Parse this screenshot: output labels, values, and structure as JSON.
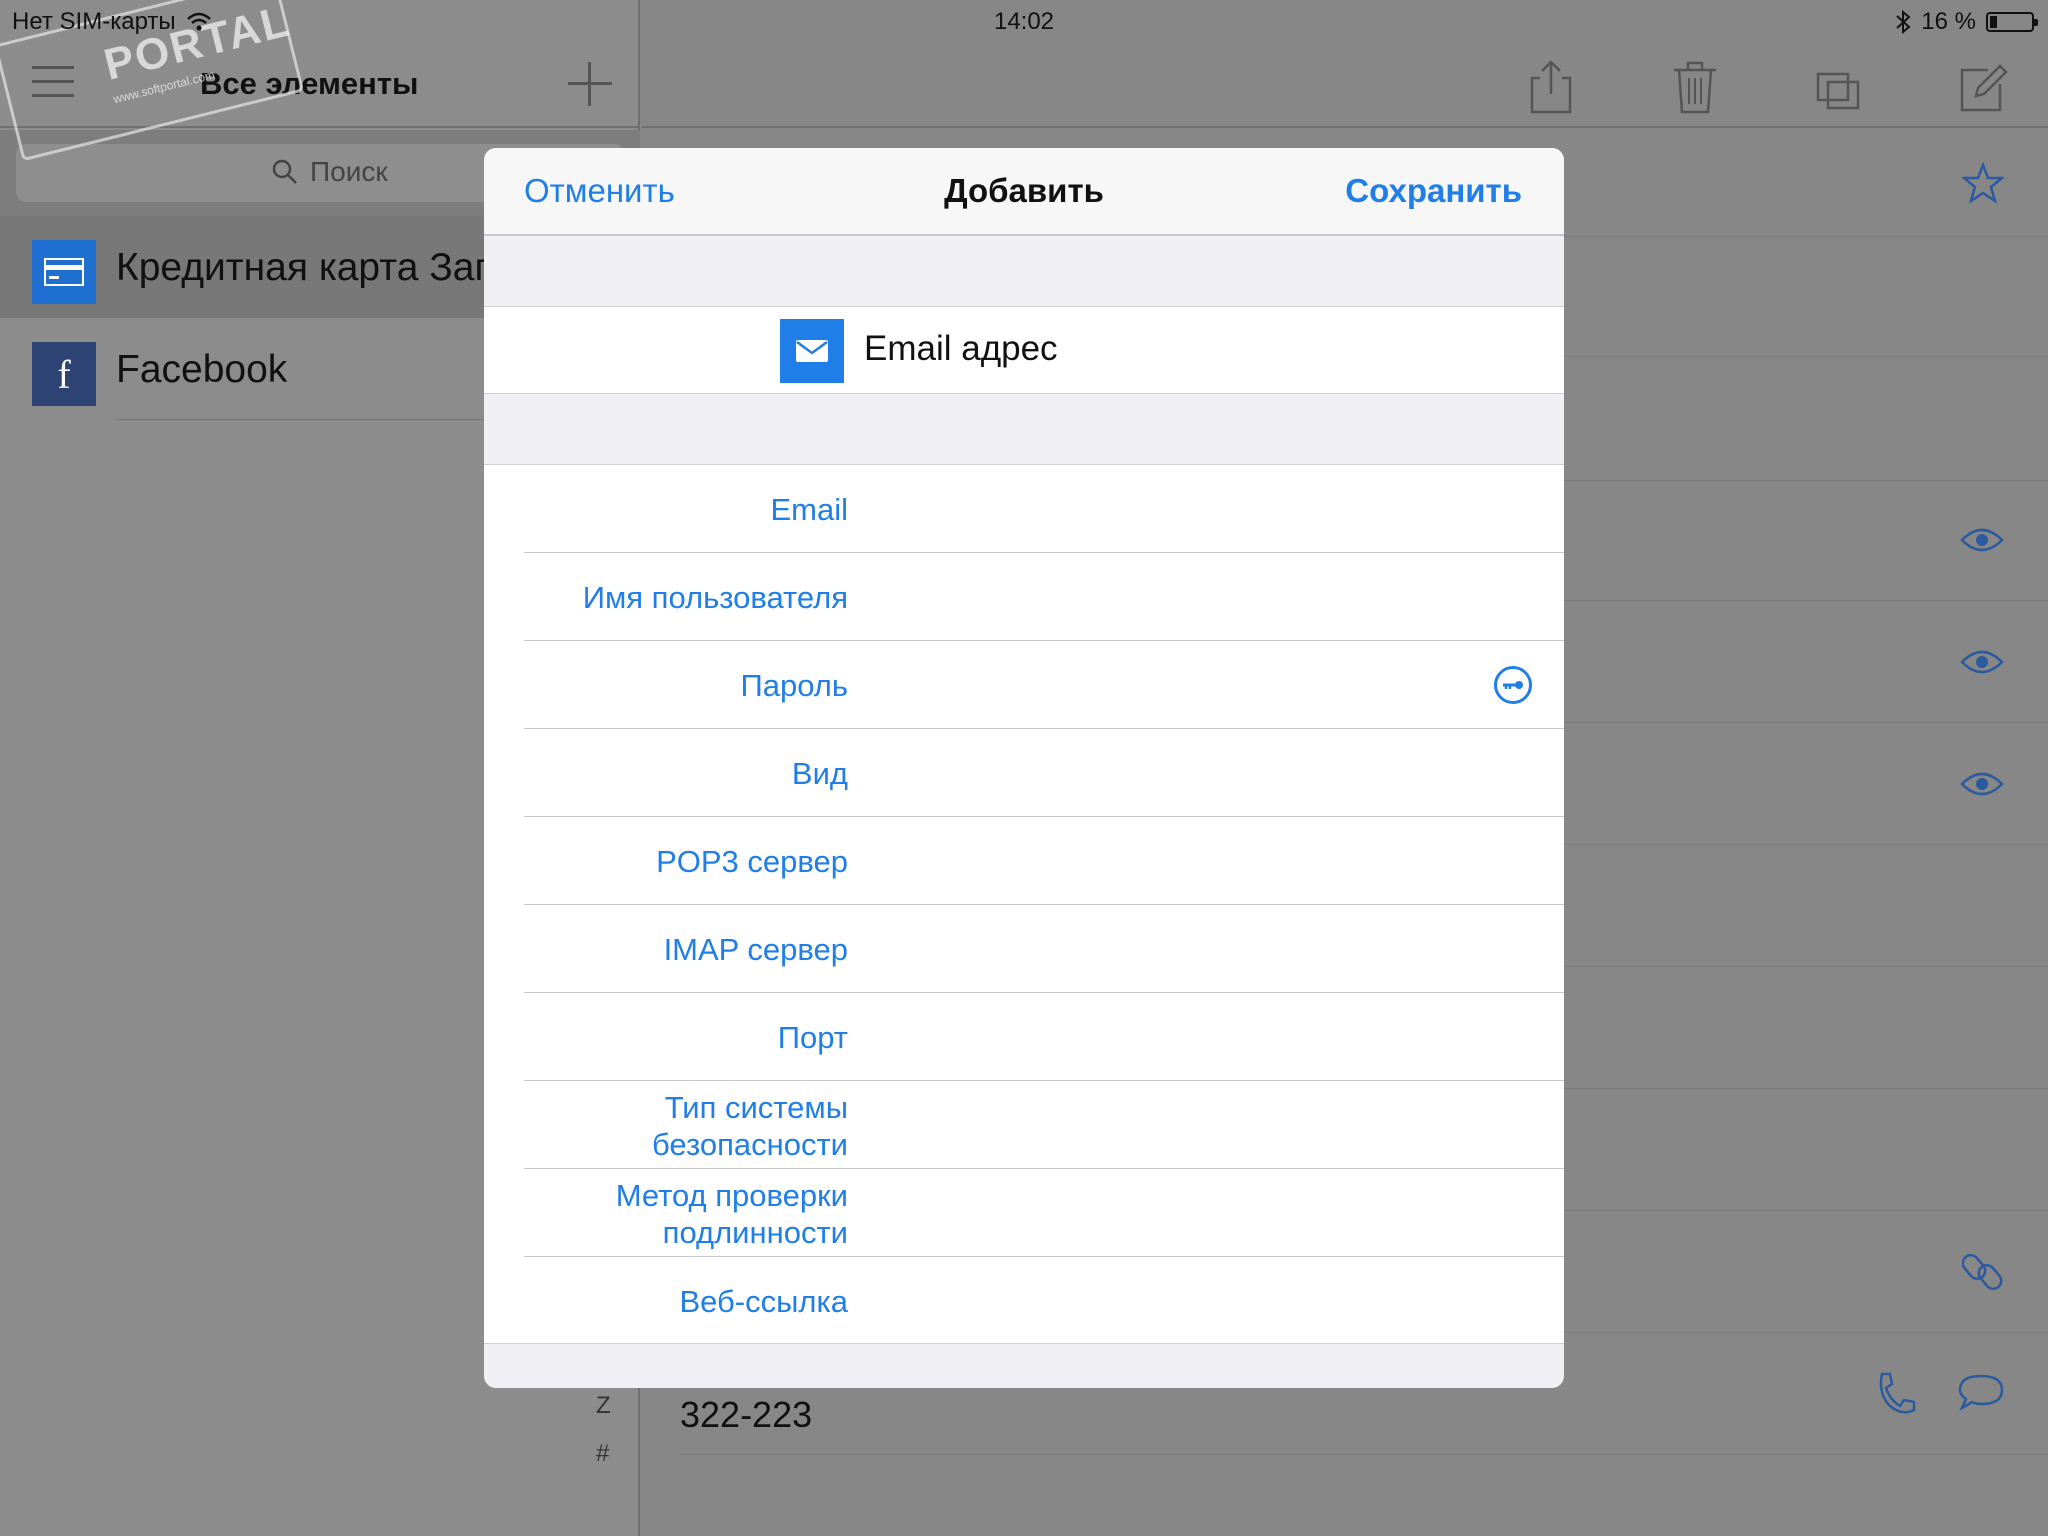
{
  "statusbar": {
    "carrier": "Нет SIM-карты",
    "time": "14:02",
    "battery": "16 %"
  },
  "sidebar": {
    "title": "Все элементы",
    "search_placeholder": "Поиск",
    "items": [
      {
        "label": "Кредитная карта Зап",
        "icon": "credit-card-icon",
        "color": "#1f6fd1"
      },
      {
        "label": "Facebook",
        "icon": "facebook-icon",
        "color": "#2d4373"
      }
    ],
    "index": [
      "Z",
      "#"
    ]
  },
  "watermark": {
    "brand": "PORTAL",
    "sub": "www.softportal.com"
  },
  "detail": {
    "phone_value": "322-223"
  },
  "modal": {
    "cancel_label": "Отменить",
    "title": "Добавить",
    "save_label": "Сохранить",
    "item_type": "Email адрес",
    "item_type_icon": "envelope-icon",
    "fields": [
      "Email",
      "Имя пользователя",
      "Пароль",
      "Вид",
      "POP3 сервер",
      "IMAP сервер",
      "Порт",
      "Тип системы безопасности",
      "Метод проверки подлинности",
      "Веб-ссылка"
    ]
  },
  "colors": {
    "accent": "#1f7ee8",
    "overlay": "#878787",
    "modal_bg": "#efeff4"
  }
}
